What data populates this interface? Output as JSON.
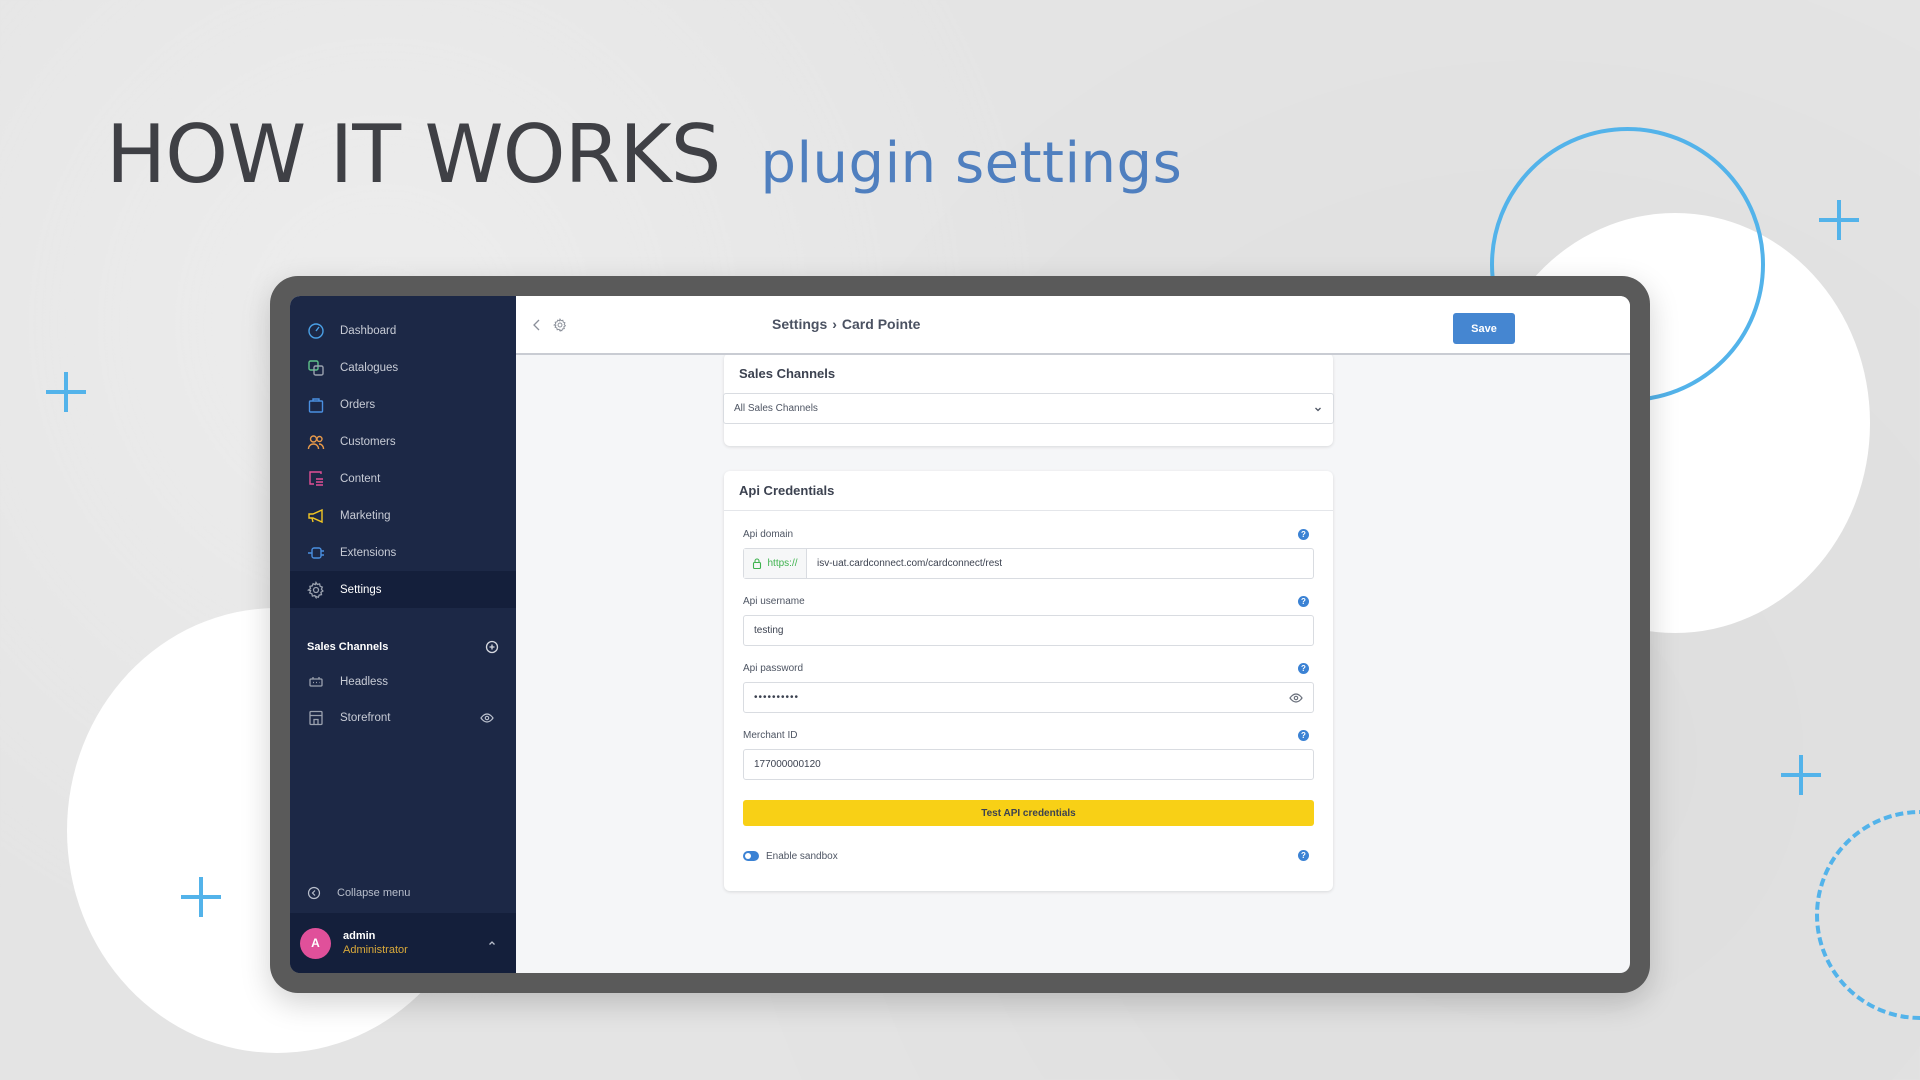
{
  "headline": {
    "main": "HOW IT WORKS",
    "sub": "plugin settings"
  },
  "colors": {
    "accent_blue": "#53b3ea",
    "sidebar_bg": "#1c2846",
    "save_button": "#4586d1",
    "test_button": "#f8d016",
    "avatar": "#e0509a"
  },
  "sidebar": {
    "items": [
      {
        "label": "Dashboard",
        "icon": "dashboard-gauge-icon",
        "color": "#4aa0e6"
      },
      {
        "label": "Catalogues",
        "icon": "catalogues-icon",
        "color": "#5fc28a"
      },
      {
        "label": "Orders",
        "icon": "orders-bag-icon",
        "color": "#4a8fe0"
      },
      {
        "label": "Customers",
        "icon": "customers-icon",
        "color": "#e89a4a"
      },
      {
        "label": "Content",
        "icon": "content-icon",
        "color": "#e24f95"
      },
      {
        "label": "Marketing",
        "icon": "megaphone-icon",
        "color": "#f2c623"
      },
      {
        "label": "Extensions",
        "icon": "plug-icon",
        "color": "#4a8fe0"
      },
      {
        "label": "Settings",
        "icon": "gear-icon",
        "color": "#9aa1ae",
        "active": true
      }
    ],
    "sales_channels": {
      "title": "Sales Channels",
      "items": [
        {
          "label": "Headless",
          "icon": "headless-icon"
        },
        {
          "label": "Storefront",
          "icon": "storefront-icon",
          "visible": true
        }
      ]
    },
    "collapse_label": "Collapse menu",
    "user": {
      "initial": "A",
      "name": "admin",
      "role": "Administrator"
    }
  },
  "topbar": {
    "breadcrumb": [
      "Settings",
      "›",
      "Card Pointe"
    ],
    "save_label": "Save"
  },
  "sales_channels_card": {
    "title": "Sales Channels",
    "select_value": "All Sales Channels"
  },
  "api_card": {
    "title": "Api Credentials",
    "fields": {
      "domain": {
        "label": "Api domain",
        "prefix": "https://",
        "value": "isv-uat.cardconnect.com/cardconnect/rest"
      },
      "username": {
        "label": "Api username",
        "value": "testing"
      },
      "password": {
        "label": "Api password",
        "value": "••••••••••"
      },
      "merchant": {
        "label": "Merchant ID",
        "value": "177000000120"
      }
    },
    "help_glyph": "?",
    "test_button": "Test API credentials",
    "sandbox": {
      "label": "Enable sandbox",
      "enabled": true
    }
  }
}
